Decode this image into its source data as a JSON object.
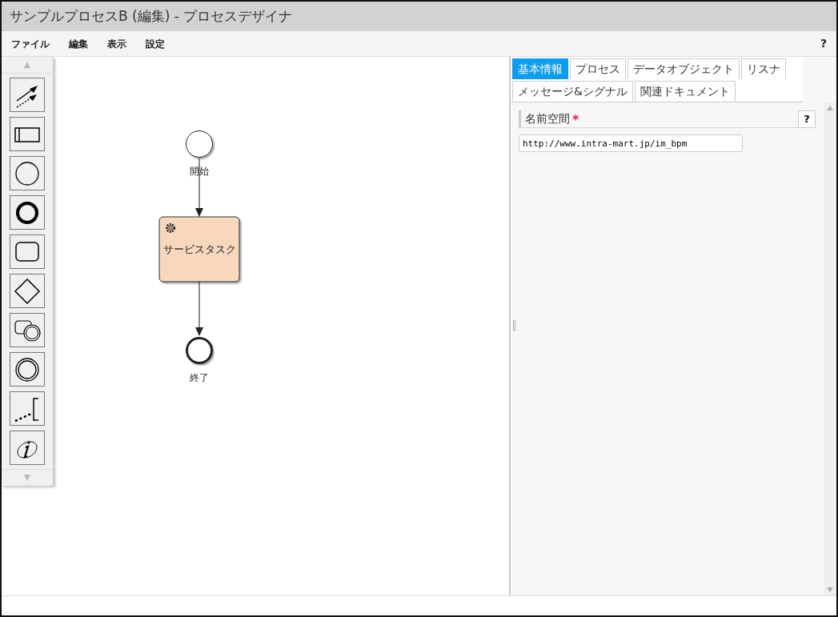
{
  "window": {
    "title": "サンプルプロセスB (編集) - プロセスデザイナ"
  },
  "menu": {
    "items": [
      "ファイル",
      "編集",
      "表示",
      "設定"
    ],
    "help": "?"
  },
  "palette": {
    "up": "▲",
    "down": "▼",
    "tools": [
      {
        "kind": "connector"
      },
      {
        "kind": "pool"
      },
      {
        "kind": "start"
      },
      {
        "kind": "end"
      },
      {
        "kind": "task"
      },
      {
        "kind": "gateway"
      },
      {
        "kind": "subprocess"
      },
      {
        "kind": "intermediate"
      },
      {
        "kind": "annotation"
      },
      {
        "kind": "data"
      }
    ]
  },
  "diagram": {
    "nodes": [
      {
        "kind": "start",
        "label": "開始"
      },
      {
        "kind": "service_task",
        "label": "サービスタスク"
      },
      {
        "kind": "end",
        "label": "終了"
      }
    ]
  },
  "tabs": [
    {
      "label": "基本情報",
      "selected": true
    },
    {
      "label": "プロセス",
      "selected": false
    },
    {
      "label": "データオブジェクト",
      "selected": false
    },
    {
      "label": "リスナ",
      "selected": false
    },
    {
      "label": "メッセージ&シグナル",
      "selected": false
    },
    {
      "label": "関連ドキュメント",
      "selected": false
    }
  ],
  "form": {
    "label": "名前空間",
    "required": true,
    "required_mark": "*",
    "help": "?",
    "value": "http://www.intra-mart.jp/im_bpm"
  }
}
